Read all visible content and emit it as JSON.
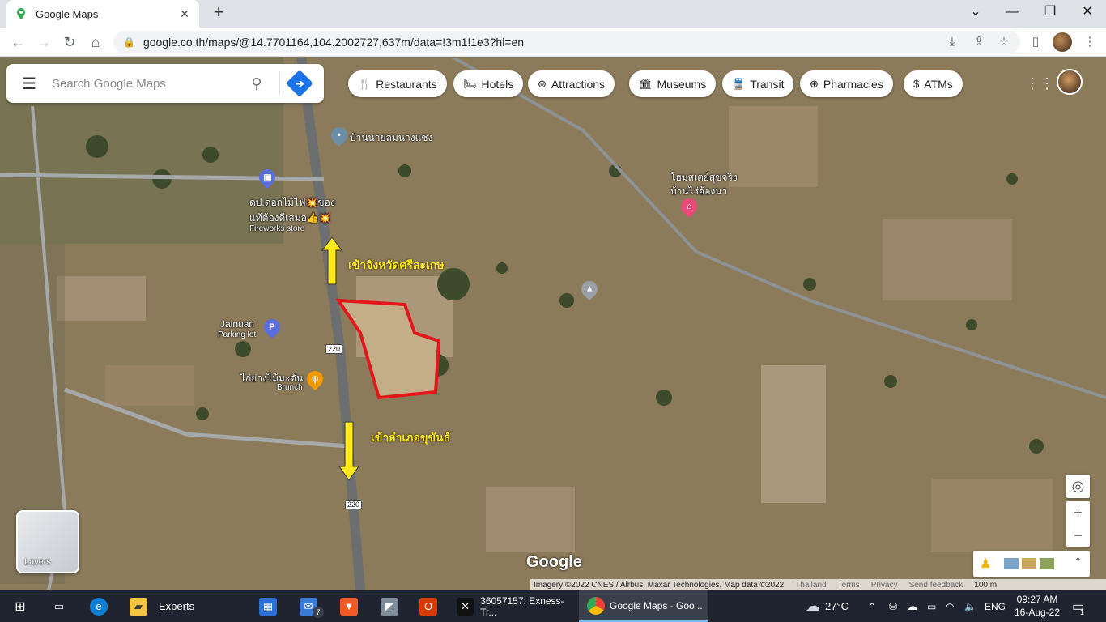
{
  "browser": {
    "tab_title": "Google Maps",
    "url": "google.co.th/maps/@14.7701164,104.2002727,637m/data=!3m1!1e3?hl=en",
    "icons": [
      "back-icon",
      "forward-icon",
      "reload-icon",
      "home-icon",
      "lock-icon",
      "install-icon",
      "share-icon",
      "star-icon",
      "sidepanel-icon"
    ]
  },
  "search": {
    "placeholder": "Search Google Maps"
  },
  "chips": [
    {
      "label": "Restaurants",
      "icon": "fork-knife-icon"
    },
    {
      "label": "Hotels",
      "icon": "bed-icon"
    },
    {
      "label": "Attractions",
      "icon": "camera-icon"
    },
    {
      "label": "Museums",
      "icon": "museum-icon"
    },
    {
      "label": "Transit",
      "icon": "train-icon"
    },
    {
      "label": "Pharmacies",
      "icon": "pharmacy-icon"
    },
    {
      "label": "ATMs",
      "icon": "atm-icon"
    }
  ],
  "places": {
    "house_label": "บ้านนายลมนางแชง",
    "fireworks_line1": "ดป.ดอกไม้ไฟ💥ของ",
    "fireworks_line2": "แท้ต้องดีเสมอ👍💥",
    "fireworks_sub": "Fireworks store",
    "homestay_line1": "โฮมสเตย์สุขจริง",
    "homestay_line2": "บ้านไร่อ้องนา",
    "parking_line1": "Jainuan",
    "parking_sub": "Parking lot",
    "restaurant_line1": "ไก่ย่างไม้มะดัน",
    "restaurant_sub": "Brunch"
  },
  "annotations": {
    "north": "เข้าจังหวัดศรีสะเกษ",
    "south": "เข้าอำเภอขุขันธ์"
  },
  "route_shield": "220",
  "layers_label": "Layers",
  "google_logo": "Google",
  "attribution": {
    "imagery": "Imagery ©2022 CNES / Airbus, Maxar Technologies, Map data ©2022",
    "country": "Thailand",
    "terms": "Terms",
    "privacy": "Privacy",
    "feedback": "Send feedback",
    "scale": "100 m"
  },
  "taskbar": {
    "folder_label": "Experts",
    "mail_badge": "7",
    "exness_label": "36057157: Exness-Tr...",
    "chrome_label": "Google Maps - Goo...",
    "weather": "27°C",
    "lang": "ENG",
    "time": "09:27 AM",
    "date": "16-Aug-22",
    "notif_count": "1"
  },
  "colors": {
    "accent_blue": "#1a73e8",
    "annotation_yellow": "#ffe81a",
    "plot_outline_red": "#e3171b"
  }
}
